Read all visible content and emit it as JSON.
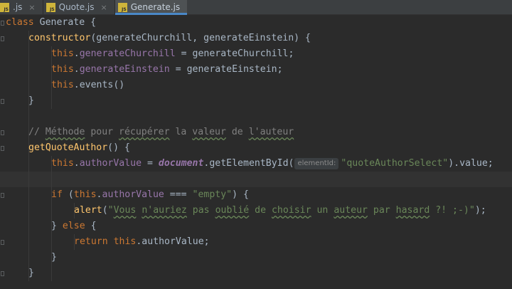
{
  "tabs": [
    {
      "name": ".js",
      "icon": "js-file-icon",
      "active": false
    },
    {
      "name": "Quote.js",
      "icon": "js-file-icon",
      "active": false
    },
    {
      "name": "Generate.js",
      "icon": "js-file-icon",
      "active": true
    }
  ],
  "tab_close_glyph": "×",
  "code": {
    "l1_class": "class",
    "l1_name": "Generate",
    "l1_brace": "{",
    "l2_kw": "constructor",
    "l2_params": "(generateChurchill, generateEinstein) {",
    "l3_this": "this",
    "l3_prop": "generateChurchill",
    "l3_rest": " = generateChurchill;",
    "l4_this": "this",
    "l4_prop": "generateEinstein",
    "l4_rest": " = generateEinstein;",
    "l5_this": "this",
    "l5_rest": ".events()",
    "l6": "}",
    "comment_prefix": "// ",
    "comment_word1": "Méthode",
    "comment_mid1": " pour ",
    "comment_word2": "récupérer",
    "comment_mid2": " la ",
    "comment_word3": "valeur",
    "comment_mid3": " de ",
    "comment_word4": "l'auteur",
    "l9_fn": "getQuoteAuthor",
    "l9_rest": "() {",
    "l10_this": "this",
    "l10_prop": "authorValue",
    "l10_eq": " = ",
    "l10_doc": "document",
    "l10_call": ".getElementById(",
    "l10_hint": "elementId:",
    "l10_str": "\"quoteAuthorSelect\"",
    "l10_end": ").value;",
    "l12_if": "if",
    "l12_open": " (",
    "l12_this": "this",
    "l12_prop": "authorValue",
    "l12_op": " === ",
    "l12_str": "\"empty\"",
    "l12_close": ") {",
    "l13_fn": "alert",
    "l13_open": "(",
    "l13_str_a": "\"",
    "l13_w1": "Vous",
    "l13_s1": " ",
    "l13_w2": "n'auriez",
    "l13_s2": " pas ",
    "l13_w3": "oublié",
    "l13_s3": " de ",
    "l13_w4": "choisir",
    "l13_s4": " un ",
    "l13_w5": "auteur",
    "l13_s5": " par ",
    "l13_w6": "hasard",
    "l13_str_b": " ?! ;-)\"",
    "l13_close": ");",
    "l14_brace": "} ",
    "l14_else": "else",
    "l14_rest": " {",
    "l15_return": "return",
    "l15_sp": " ",
    "l15_this": "this",
    "l15_rest": ".authorValue;",
    "l16": "}",
    "l17": "}"
  }
}
